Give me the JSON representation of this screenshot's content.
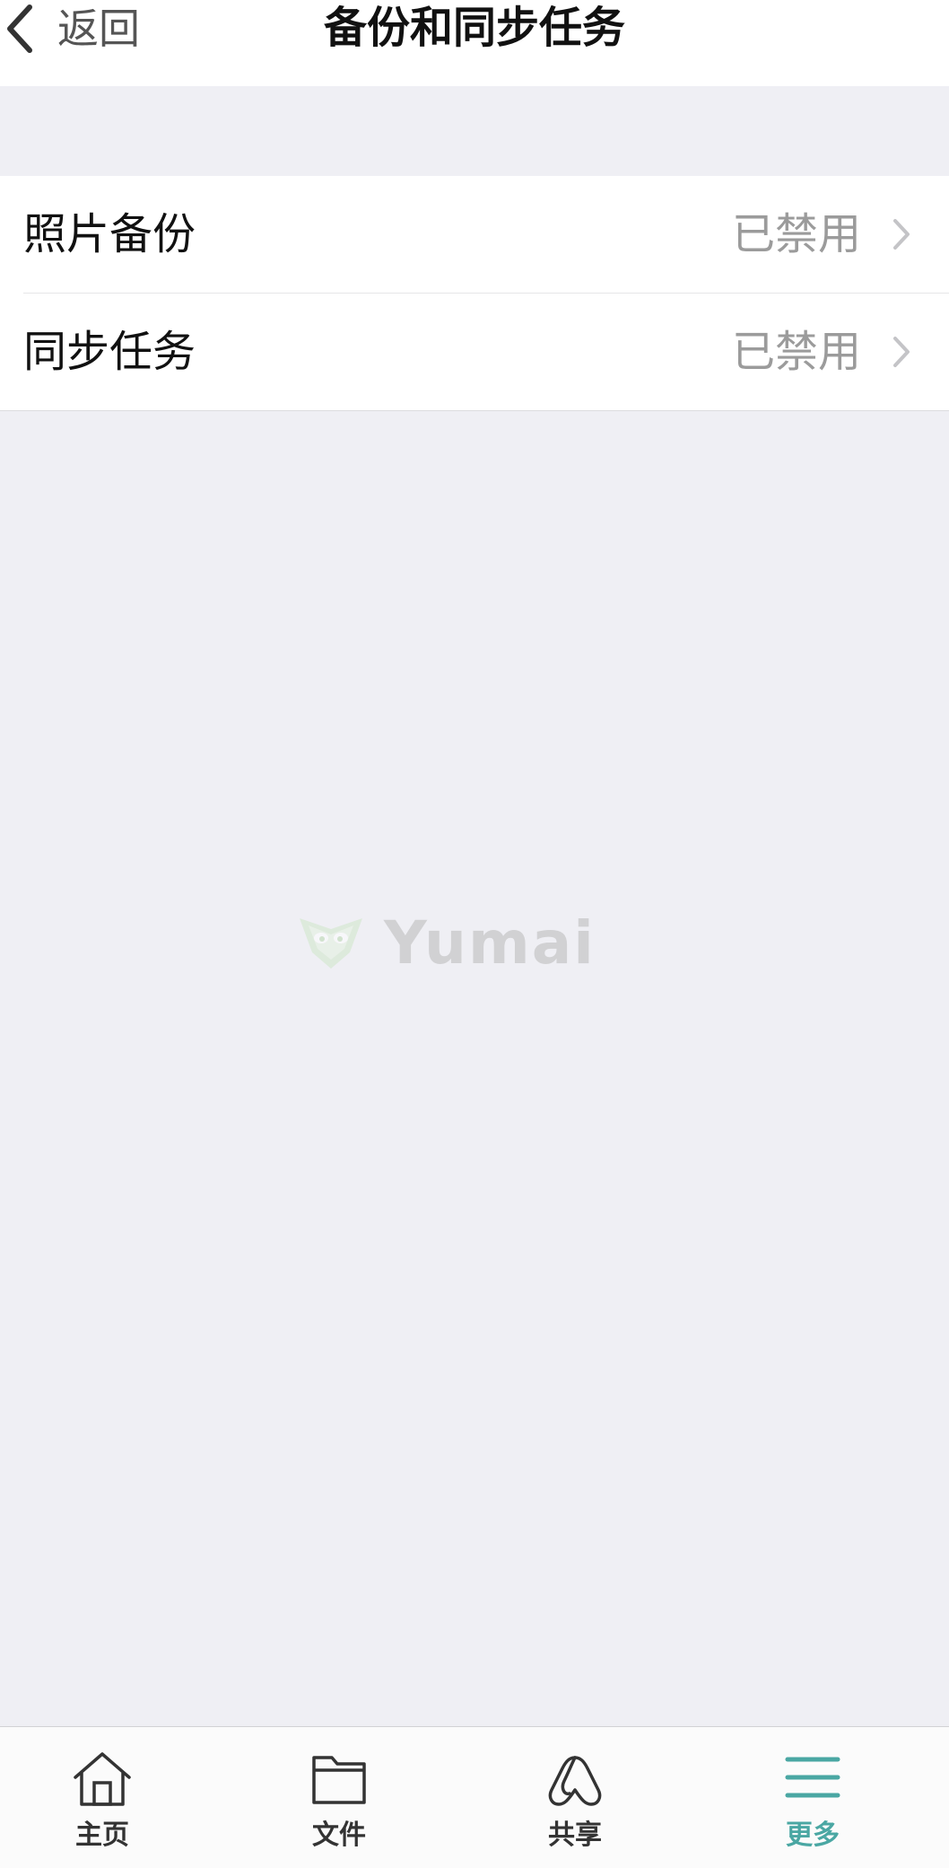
{
  "nav": {
    "back_label": "返回",
    "back_icon": "chevron-left-icon",
    "title": "备份和同步任务"
  },
  "settings": {
    "items": [
      {
        "title": "照片备份",
        "value": "已禁用",
        "icon": "chevron-right-icon"
      },
      {
        "title": "同步任务",
        "value": "已禁用",
        "icon": "chevron-right-icon"
      }
    ]
  },
  "watermark": {
    "text": "Yumai"
  },
  "tabbar": {
    "items": [
      {
        "label": "主页",
        "icon": "home-icon",
        "active": false
      },
      {
        "label": "文件",
        "icon": "folder-icon",
        "active": false
      },
      {
        "label": "共享",
        "icon": "share-icon",
        "active": false
      },
      {
        "label": "更多",
        "icon": "menu-icon",
        "active": true
      }
    ]
  },
  "colors": {
    "background": "#efeff4",
    "surface": "#ffffff",
    "accent": "#4aa7a3",
    "secondary_text": "#9b9b9b",
    "primary_text": "#111111"
  }
}
